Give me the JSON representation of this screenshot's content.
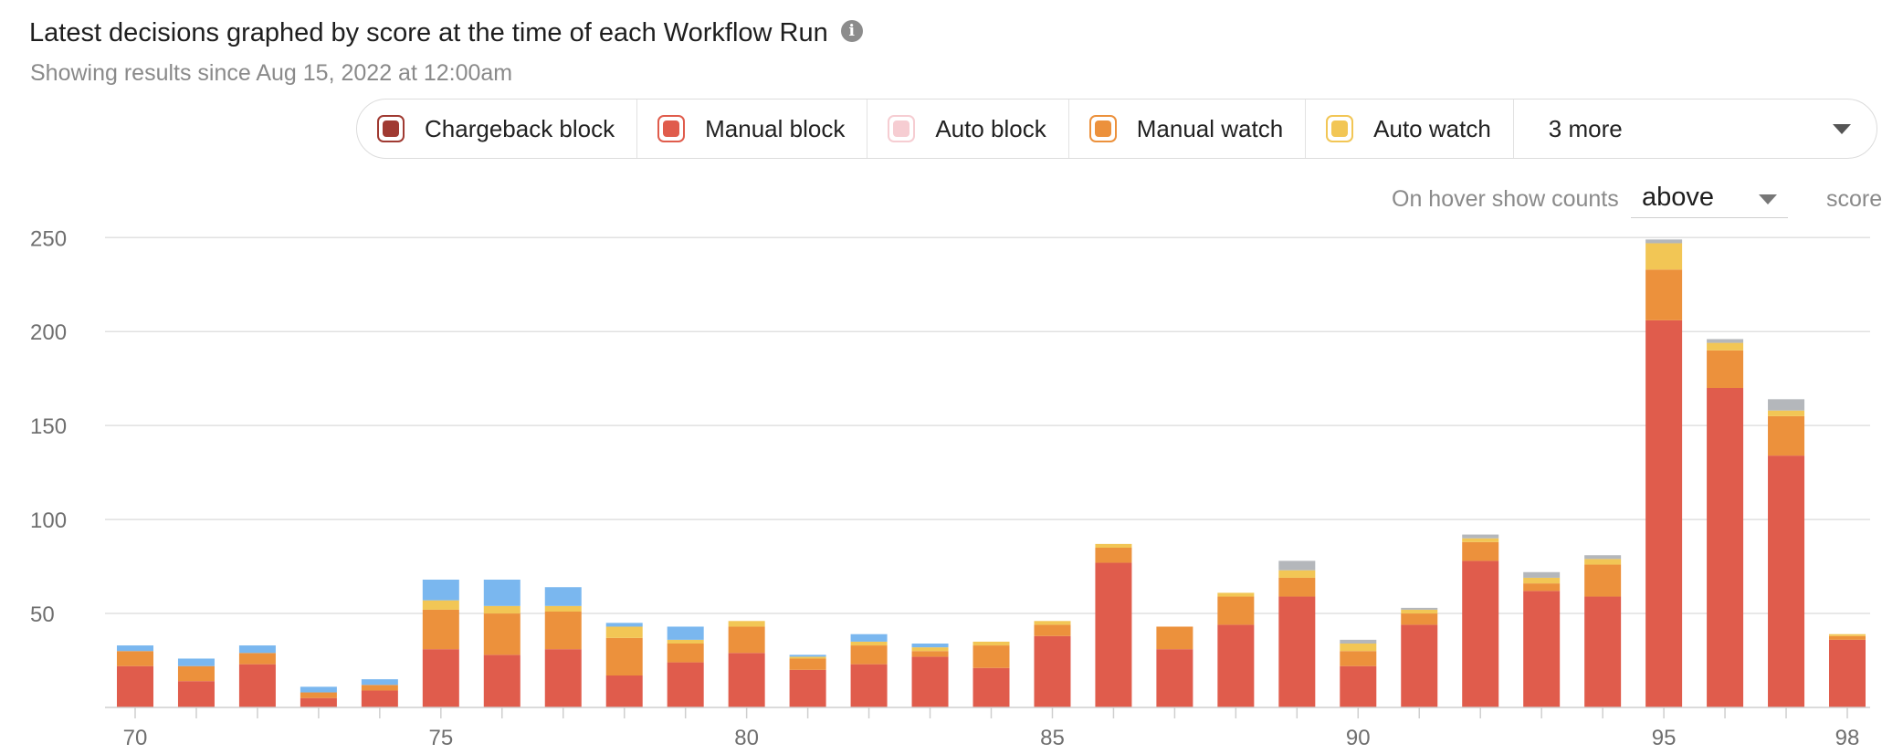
{
  "header": {
    "title": "Latest decisions graphed by score at the time of each Workflow Run",
    "info_icon": "i",
    "subtitle": "Showing results since Aug 15, 2022 at 12:00am"
  },
  "legend": {
    "items": [
      {
        "label": "Chargeback block",
        "color": "#a03a32"
      },
      {
        "label": "Manual block",
        "color": "#e05c4c"
      },
      {
        "label": "Auto block",
        "color": "#f6cdd2"
      },
      {
        "label": "Manual watch",
        "color": "#ec913c"
      },
      {
        "label": "Auto watch",
        "color": "#f2c655"
      }
    ],
    "more_label": "3 more"
  },
  "hover_control": {
    "label": "On hover show counts",
    "selected": "above",
    "unit": "score"
  },
  "chart_data": {
    "type": "bar",
    "stacked": true,
    "x": [
      70,
      71,
      72,
      73,
      74,
      75,
      76,
      77,
      78,
      79,
      80,
      81,
      82,
      83,
      84,
      85,
      86,
      87,
      88,
      89,
      90,
      91,
      92,
      93,
      94,
      95,
      96,
      97,
      98
    ],
    "x_ticks": [
      70,
      75,
      80,
      85,
      90,
      95,
      98
    ],
    "y_ticks": [
      50,
      100,
      150,
      200,
      250
    ],
    "ylim": [
      0,
      255
    ],
    "grid": true,
    "series": [
      {
        "name": "Manual block",
        "color": "#e05c4c",
        "values": [
          22,
          14,
          23,
          5,
          9,
          31,
          28,
          31,
          17,
          24,
          29,
          20,
          23,
          27,
          21,
          38,
          77,
          31,
          44,
          59,
          22,
          44,
          78,
          62,
          59,
          206,
          170,
          134,
          36
        ]
      },
      {
        "name": "Manual watch",
        "color": "#ec913c",
        "values": [
          8,
          8,
          6,
          3,
          3,
          21,
          22,
          20,
          20,
          10,
          14,
          6,
          10,
          3,
          12,
          6,
          8,
          12,
          15,
          10,
          8,
          6,
          10,
          4,
          17,
          27,
          20,
          21,
          2
        ]
      },
      {
        "name": "Auto watch",
        "color": "#f2c655",
        "values": [
          0,
          0,
          0,
          0,
          0,
          5,
          4,
          3,
          6,
          2,
          3,
          1,
          2,
          2,
          2,
          2,
          2,
          0,
          2,
          4,
          4,
          2,
          2,
          3,
          3,
          14,
          4,
          3,
          1
        ]
      },
      {
        "color": "#b4b7bb",
        "values": [
          0,
          0,
          0,
          0,
          0,
          0,
          0,
          0,
          0,
          0,
          0,
          0,
          0,
          0,
          0,
          0,
          0,
          0,
          0,
          5,
          2,
          1,
          2,
          3,
          2,
          2,
          2,
          6,
          0
        ]
      },
      {
        "color": "#7ab7ef",
        "values": [
          3,
          4,
          4,
          3,
          3,
          11,
          14,
          10,
          2,
          7,
          0,
          1,
          4,
          2,
          0,
          0,
          0,
          0,
          0,
          0,
          0,
          0,
          0,
          0,
          0,
          0,
          0,
          0,
          0
        ]
      }
    ]
  }
}
